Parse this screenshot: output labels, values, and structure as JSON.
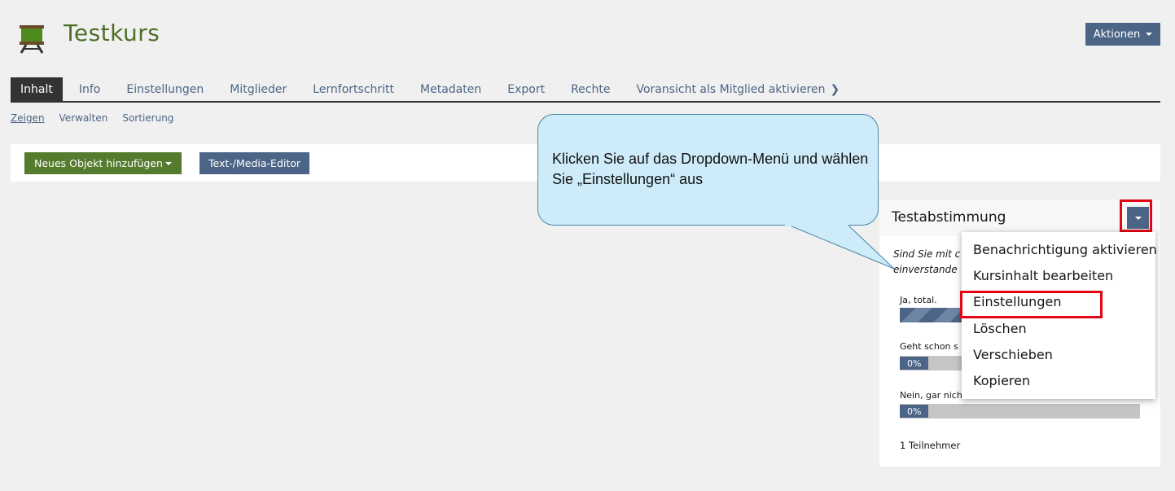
{
  "header": {
    "title": "Testkurs",
    "actions_label": "Aktionen"
  },
  "tabs": [
    {
      "label": "Inhalt",
      "active": true
    },
    {
      "label": "Info"
    },
    {
      "label": "Einstellungen"
    },
    {
      "label": "Mitglieder"
    },
    {
      "label": "Lernfortschritt"
    },
    {
      "label": "Metadaten"
    },
    {
      "label": "Export"
    },
    {
      "label": "Rechte"
    },
    {
      "label": "Voransicht als Mitglied aktivieren"
    }
  ],
  "subtabs": [
    {
      "label": "Zeigen",
      "active": true
    },
    {
      "label": "Verwalten"
    },
    {
      "label": "Sortierung"
    }
  ],
  "toolbar": {
    "add_label": "Neues Objekt hinzufügen",
    "editor_label": "Text-/Media-Editor"
  },
  "poll": {
    "title": "Testabstimmung",
    "question_line1": "Sind Sie mit c",
    "question_line2": "einverstande",
    "answers": [
      {
        "label": "Ja, total.",
        "percent": 100,
        "pct_text": ""
      },
      {
        "label": "Geht schon s",
        "percent": 0,
        "pct_text": "0%"
      },
      {
        "label": "Nein, gar nicht",
        "percent": 0,
        "pct_text": "0%"
      }
    ],
    "participants": "1 Teilnehmer"
  },
  "dropdown": {
    "items": [
      "Benachrichtigung aktivieren",
      "Kursinhalt bearbeiten",
      "Einstellungen",
      "Löschen",
      "Verschieben",
      "Kopieren"
    ],
    "highlighted": "Einstellungen"
  },
  "callout": {
    "text": "Klicken Sie auf das Dropdown-Menü und wählen Sie „Einstellungen“ aus"
  },
  "colors": {
    "accent": "#4c6586",
    "green": "#557b2e",
    "title_green": "#4d6f26",
    "highlight": "#e30613",
    "callout_bg": "#cdebf8"
  }
}
